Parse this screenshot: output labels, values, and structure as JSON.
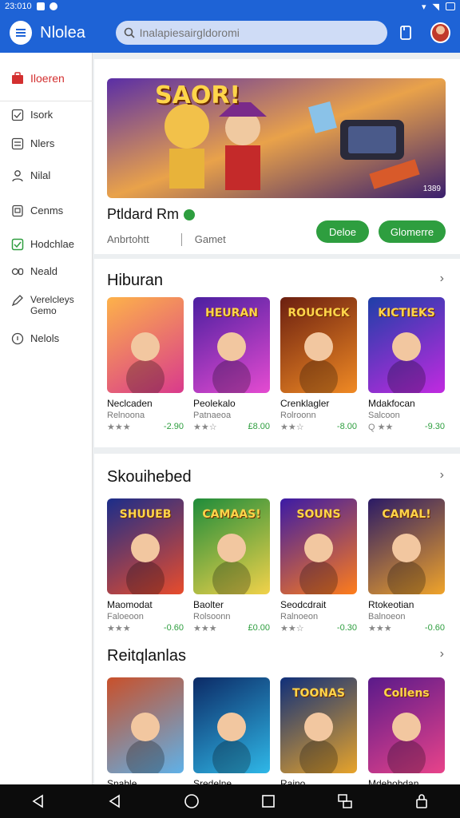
{
  "statusbar": {
    "time": "23:010"
  },
  "appbar": {
    "title": "Nlolea",
    "search_placeholder": "Inalapiesairgldoromi"
  },
  "sidebar": {
    "items": [
      {
        "label": "Iloeren",
        "icon": "store-icon"
      },
      {
        "label": "Isork",
        "icon": "checkbox-icon"
      },
      {
        "label": "Nlers",
        "icon": "list-icon"
      },
      {
        "label": "Nilal",
        "icon": "person-icon"
      },
      {
        "label": "Cenms",
        "icon": "device-icon"
      },
      {
        "label": "Hodchlae",
        "icon": "check-square-icon"
      },
      {
        "label": "Neald",
        "icon": "gd-icon"
      },
      {
        "label": "Verelcleys Gemo",
        "icon": "pen-icon"
      },
      {
        "label": "Nelols",
        "icon": "circle-icon"
      }
    ]
  },
  "featured": {
    "title": "Ptldard Rm",
    "meta_left": "Anbrtohtt",
    "meta_right": "Gamet",
    "image_badge": "1389",
    "image_caption": "SAOR!",
    "button_primary": "Deloe",
    "button_secondary": "Glomerre"
  },
  "sections": [
    {
      "title": "Hiburan",
      "tiles": [
        {
          "name": "Neclcaden",
          "sub": "Relnoona",
          "stars": "★★★",
          "price": "-2.90",
          "art": "",
          "colors": [
            "#fdb24a",
            "#d93a8c"
          ]
        },
        {
          "name": "Peolekalo",
          "sub": "Patnaeoa",
          "stars": "★★☆",
          "price": "£8.00",
          "art": "HEURAN",
          "colors": [
            "#4b1fa0",
            "#e54bd1"
          ]
        },
        {
          "name": "Crenklagler",
          "sub": "Rolroonn",
          "stars": "★★☆",
          "price": "-8.00",
          "art": "ROUCHCK",
          "colors": [
            "#6b1f10",
            "#f08a24"
          ]
        },
        {
          "name": "Mdakfocan",
          "sub": "Salcoon",
          "stars": "Q ★★",
          "price": "-9.30",
          "art": "KICTIEKS",
          "colors": [
            "#1e3fa8",
            "#c12ae0"
          ]
        }
      ]
    },
    {
      "title": "Skouihebed",
      "tiles": [
        {
          "name": "Maomodat",
          "sub": "Faloeoon",
          "stars": "★★★",
          "price": "-0.60",
          "art": "SHUUEB",
          "colors": [
            "#1b2d8a",
            "#e84c2c"
          ]
        },
        {
          "name": "Baolter",
          "sub": "Rolsoonn",
          "stars": "★★★",
          "price": "£0.00",
          "art": "CAMAAS!",
          "colors": [
            "#1e8c3a",
            "#f2d24a"
          ]
        },
        {
          "name": "Seodcdrait",
          "sub": "Ralnoeon",
          "stars": "★★☆",
          "price": "-0.30",
          "art": "SOUNS",
          "colors": [
            "#3b1aa6",
            "#ff7d1a"
          ]
        },
        {
          "name": "Rtokeotian",
          "sub": "Balnoeon",
          "stars": "★★★",
          "price": "-0.60",
          "art": "CAMAL!",
          "colors": [
            "#2a1a66",
            "#f0a42a"
          ]
        }
      ]
    },
    {
      "title": "Reitqlanlas",
      "tiles": [
        {
          "name": "Snable",
          "sub": "",
          "stars": "",
          "price": "",
          "art": "",
          "colors": [
            "#c9502a",
            "#5fb1e8"
          ]
        },
        {
          "name": "Sredelne",
          "sub": "",
          "stars": "",
          "price": "",
          "art": "",
          "colors": [
            "#0c2a66",
            "#2fb8e8"
          ]
        },
        {
          "name": "Raino",
          "sub": "",
          "stars": "",
          "price": "",
          "art": "TOONAS",
          "colors": [
            "#0f2f7a",
            "#e8a42a"
          ]
        },
        {
          "name": "Mdehobdan",
          "sub": "",
          "stars": "",
          "price": "",
          "art": "Collens",
          "colors": [
            "#5a1a8a",
            "#e8438a"
          ]
        }
      ]
    }
  ]
}
